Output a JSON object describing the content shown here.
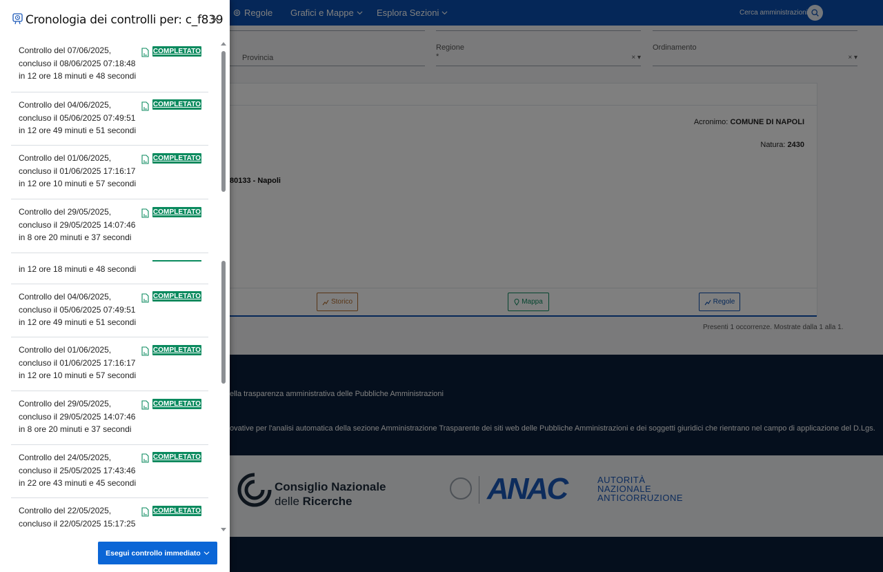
{
  "background": {
    "nav": {
      "rules": "Regole",
      "charts": "Grafici e Mappe",
      "sections": "Esplora Sezioni",
      "search_placeholder": "Cerca amministrazioni"
    },
    "filters": {
      "province_label": "Provincia",
      "region_label": "Regione",
      "region_value": "*",
      "order_label": "Ordinamento"
    },
    "card": {
      "acronym_label": "Acronimo:",
      "acronym_value": "COMUNE DI NAPOLI",
      "nature_label": "Natura:",
      "nature_value": "2430",
      "address": "80133 - Napoli",
      "btn_history": "Storico",
      "btn_map": "Mappa",
      "btn_rules": "Regole"
    },
    "occurrences": "Presenti 1 occorrenze. Mostrate dalla 1 alla 1.",
    "footer": {
      "line1": "ella trasparenza amministrativa delle Pubbliche Amministrazioni",
      "line2": "ovative per l'analisi automatica della sezione Amministrazione Trasparente dei siti web delle Pubbliche Amministrazioni e dei soggetti giuridici che rientrano nel campo di applicazione del D.Lgs.",
      "cnr_line1": "Consiglio Nazionale",
      "cnr_line2a": "delle ",
      "cnr_line2b": "Ricerche",
      "anac_logo": "ANAC",
      "anac_l1": "AUTORITÀ",
      "anac_l2": "NAZIONALE",
      "anac_l3": "ANTICORRUZIONE"
    }
  },
  "panel": {
    "title": "Cronologia dei controlli per: c_f839",
    "badge_label": "COMPLETATO",
    "items": [
      {
        "l1": "Controllo del 07/06/2025,",
        "l2": "concluso il 08/06/2025 07:18:48",
        "l3": "in 12 ore 18 minuti e 48 secondi"
      },
      {
        "l1": "Controllo del 04/06/2025,",
        "l2": "concluso il 05/06/2025 07:49:51",
        "l3": "in 12 ore 49 minuti e 51 secondi"
      },
      {
        "l1": "Controllo del 01/06/2025,",
        "l2": "concluso il 01/06/2025 17:16:17",
        "l3": "in 12 ore 10 minuti e 57 secondi"
      },
      {
        "l1": "Controllo del 29/05/2025,",
        "l2": "concluso il 29/05/2025 14:07:46",
        "l3": "in 8 ore 20 minuti e 37 secondi"
      },
      {
        "l3": "in 12 ore 18 minuti e 48 secondi"
      },
      {
        "l1": "Controllo del 04/06/2025,",
        "l2": "concluso il 05/06/2025 07:49:51",
        "l3": "in 12 ore 49 minuti e 51 secondi"
      },
      {
        "l1": "Controllo del 01/06/2025,",
        "l2": "concluso il 01/06/2025 17:16:17",
        "l3": "in 12 ore 10 minuti e 57 secondi"
      },
      {
        "l1": "Controllo del 29/05/2025,",
        "l2": "concluso il 29/05/2025 14:07:46",
        "l3": "in 8 ore 20 minuti e 37 secondi"
      },
      {
        "l1": "Controllo del 24/05/2025,",
        "l2": "concluso il 25/05/2025 17:43:46",
        "l3": "in 22 ore 43 minuti e 45 secondi"
      },
      {
        "l1": "Controllo del 22/05/2025,",
        "l2": "concluso il 22/05/2025 15:17:25"
      }
    ],
    "run_button": "Esegui controllo immediato"
  },
  "colors": {
    "brand_blue": "#0b4fb0",
    "badge_green": "#0a8a5e",
    "button_blue": "#0b66d6",
    "footer_dark": "#0b1f3a"
  }
}
